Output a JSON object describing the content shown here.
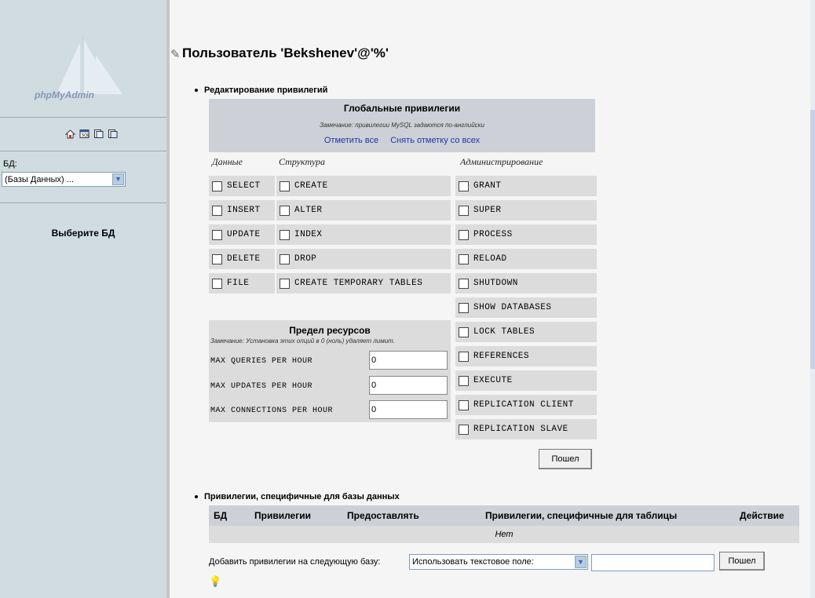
{
  "left_panel": {
    "logo_text": "phpMyAdmin",
    "db_label": "БД:",
    "db_select_value": "(Базы Данных) ...",
    "choose_db": "Выберите БД",
    "icons": [
      "home-icon",
      "query-window-icon",
      "docs-icon",
      "mysql-docs-icon"
    ]
  },
  "page": {
    "title": "Пользователь 'Bekshenev'@'%'"
  },
  "privileges": {
    "section_title": "Редактирование привилегий",
    "box_title": "Глобальные привилегии",
    "note": "Замечание: привилегии MySQL задаются по-английски",
    "check_all": "Отметить все",
    "uncheck_all": "Снять отметку со всех",
    "columns": {
      "data": "Данные",
      "structure": "Структура",
      "admin": "Администрирование"
    },
    "data": [
      "SELECT",
      "INSERT",
      "UPDATE",
      "DELETE",
      "FILE"
    ],
    "structure": [
      "CREATE",
      "ALTER",
      "INDEX",
      "DROP",
      "CREATE TEMPORARY TABLES"
    ],
    "admin": [
      "GRANT",
      "SUPER",
      "PROCESS",
      "RELOAD",
      "SHUTDOWN",
      "SHOW DATABASES",
      "LOCK TABLES",
      "REFERENCES",
      "EXECUTE",
      "REPLICATION CLIENT",
      "REPLICATION SLAVE"
    ]
  },
  "resources": {
    "title": "Предел ресурсов",
    "note": "Замечание: Установка этих опций в 0 (ноль) удаляет лимит.",
    "rows": [
      {
        "label": "MAX QUERIES PER HOUR",
        "value": "0"
      },
      {
        "label": "MAX UPDATES PER HOUR",
        "value": "0"
      },
      {
        "label": "MAX CONNECTIONS PER HOUR",
        "value": "0"
      }
    ]
  },
  "go_button": "Пошел",
  "db_specific": {
    "section_title": "Привилегии, специфичные для базы данных",
    "headers": [
      "БД",
      "Привилегии",
      "Предоставлять",
      "Привилегии, специфичные для таблицы",
      "Действие"
    ],
    "empty": "Нет",
    "add_label": "Добавить привилегии на следующую базу:",
    "select_value": "Использовать текстовое поле:",
    "input_value": "",
    "go_button": "Пошел"
  }
}
